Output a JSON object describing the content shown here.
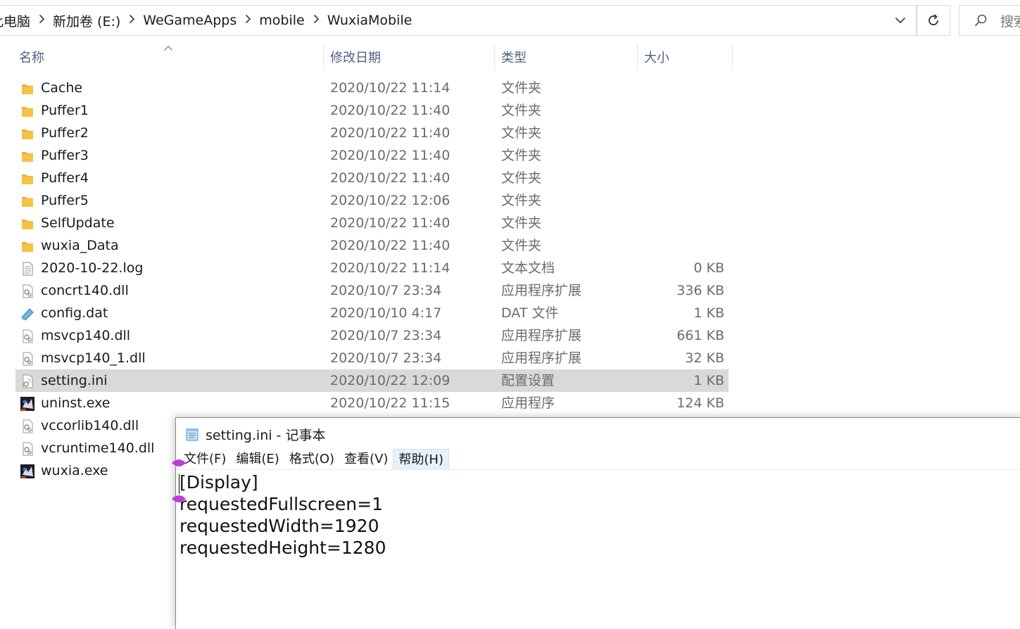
{
  "address_bar": {
    "breadcrumbs": [
      "此电脑",
      "新加卷 (E:)",
      "WeGameApps",
      "mobile",
      "WuxiaMobile"
    ],
    "search_placeholder": "搜索"
  },
  "columns": {
    "name": "名称",
    "date": "修改日期",
    "type": "类型",
    "size": "大小"
  },
  "files": [
    {
      "name": "Cache",
      "date": "2020/10/22 11:14",
      "type": "文件夹",
      "size": "",
      "icon": "folder-icon"
    },
    {
      "name": "Puffer1",
      "date": "2020/10/22 11:40",
      "type": "文件夹",
      "size": "",
      "icon": "folder-icon"
    },
    {
      "name": "Puffer2",
      "date": "2020/10/22 11:40",
      "type": "文件夹",
      "size": "",
      "icon": "folder-icon"
    },
    {
      "name": "Puffer3",
      "date": "2020/10/22 11:40",
      "type": "文件夹",
      "size": "",
      "icon": "folder-icon"
    },
    {
      "name": "Puffer4",
      "date": "2020/10/22 11:40",
      "type": "文件夹",
      "size": "",
      "icon": "folder-icon"
    },
    {
      "name": "Puffer5",
      "date": "2020/10/22 12:06",
      "type": "文件夹",
      "size": "",
      "icon": "folder-icon"
    },
    {
      "name": "SelfUpdate",
      "date": "2020/10/22 11:40",
      "type": "文件夹",
      "size": "",
      "icon": "folder-icon"
    },
    {
      "name": "wuxia_Data",
      "date": "2020/10/22 11:40",
      "type": "文件夹",
      "size": "",
      "icon": "folder-icon"
    },
    {
      "name": "2020-10-22.log",
      "date": "2020/10/22 11:14",
      "type": "文本文档",
      "size": "0 KB",
      "icon": "text-document-icon"
    },
    {
      "name": "concrt140.dll",
      "date": "2020/10/7 23:34",
      "type": "应用程序扩展",
      "size": "336 KB",
      "icon": "dll-gear-icon"
    },
    {
      "name": "config.dat",
      "date": "2020/10/10 4:17",
      "type": "DAT 文件",
      "size": "1 KB",
      "icon": "dat-file-icon"
    },
    {
      "name": "msvcp140.dll",
      "date": "2020/10/7 23:34",
      "type": "应用程序扩展",
      "size": "661 KB",
      "icon": "dll-gear-icon"
    },
    {
      "name": "msvcp140_1.dll",
      "date": "2020/10/7 23:34",
      "type": "应用程序扩展",
      "size": "32 KB",
      "icon": "dll-gear-icon"
    },
    {
      "name": "setting.ini",
      "date": "2020/10/22 12:09",
      "type": "配置设置",
      "size": "1 KB",
      "icon": "ini-settings-icon"
    },
    {
      "name": "uninst.exe",
      "date": "2020/10/22 11:15",
      "type": "应用程序",
      "size": "124 KB",
      "icon": "game-exe-icon"
    },
    {
      "name": "vccorlib140.dll",
      "date": "",
      "type": "",
      "size": "",
      "icon": "dll-gear-icon"
    },
    {
      "name": "vcruntime140.dll",
      "date": "",
      "type": "",
      "size": "",
      "icon": "dll-gear-icon"
    },
    {
      "name": "wuxia.exe",
      "date": "",
      "type": "",
      "size": "",
      "icon": "game-exe-icon"
    }
  ],
  "selected_file": "setting.ini",
  "notepad": {
    "title": "setting.ini - 记事本",
    "menu": [
      "文件(F)",
      "编辑(E)",
      "格式(O)",
      "查看(V)",
      "帮助(H)"
    ],
    "active_menu": "帮助(H)",
    "lines": [
      "[Display]",
      "requestedFullscreen=1",
      "requestedWidth=1920",
      "requestedHeight=1280"
    ]
  },
  "colors": {
    "header_text": "#4d6283",
    "selection": "#d9d9d9",
    "folder": "#f5c342",
    "menu_highlight": "#e5f1fb",
    "handle": "#c03bdc"
  }
}
